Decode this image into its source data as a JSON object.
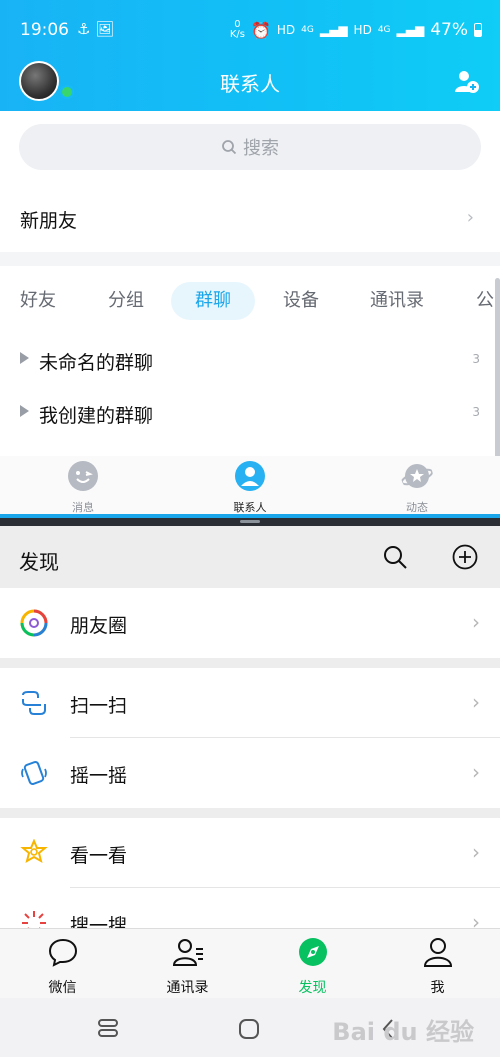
{
  "status_bar": {
    "time": "19:06",
    "net_speed_top": "0",
    "net_speed_unit": "K/s",
    "hd1": "HD",
    "net1": "4G",
    "hd2": "HD",
    "net2": "4G",
    "battery": "47%"
  },
  "qq": {
    "title": "联系人",
    "search_placeholder": "搜索",
    "new_friends": "新朋友",
    "tabs": [
      "好友",
      "分组",
      "群聊",
      "设备",
      "通讯录",
      "公"
    ],
    "active_tab": "群聊",
    "groups": [
      {
        "label": "未命名的群聊",
        "count": "3"
      },
      {
        "label": "我创建的群聊",
        "count": "3"
      }
    ],
    "tabbar": [
      {
        "label": "消息",
        "icon": "message-face-icon"
      },
      {
        "label": "联系人",
        "icon": "contacts-person-icon"
      },
      {
        "label": "动态",
        "icon": "planet-star-icon"
      }
    ],
    "colors": {
      "header": "#18b3f5",
      "accent": "#1aa6ea"
    }
  },
  "wechat": {
    "title": "发现",
    "items": [
      {
        "label": "朋友圈",
        "icon": "moments-aperture-icon"
      },
      {
        "label": "扫一扫",
        "icon": "scan-icon"
      },
      {
        "label": "摇一摇",
        "icon": "shake-phone-icon"
      },
      {
        "label": "看一看",
        "icon": "top-stories-icon"
      },
      {
        "label": "搜一搜",
        "icon": "search-spark-icon"
      }
    ],
    "tabbar": [
      {
        "label": "微信",
        "icon": "chat-bubble-icon"
      },
      {
        "label": "通讯录",
        "icon": "contacts-icon"
      },
      {
        "label": "发现",
        "icon": "compass-icon"
      },
      {
        "label": "我",
        "icon": "me-person-icon"
      }
    ],
    "colors": {
      "active": "#07c160"
    }
  },
  "watermark": "Bai du 经验"
}
